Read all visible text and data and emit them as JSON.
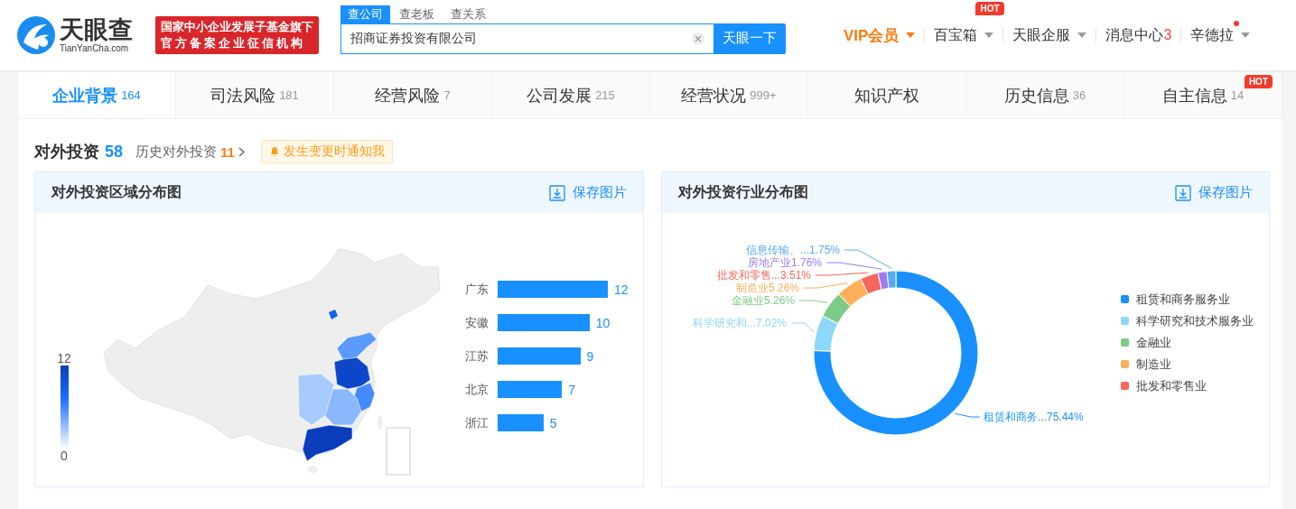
{
  "header": {
    "logo": {
      "name": "天眼查",
      "domain": "TianYanCha.com"
    },
    "slogan": [
      "国家中小企业发展子基金旗下",
      "官方备案企业征信机构"
    ],
    "search": {
      "tabs": [
        {
          "label": "查公司",
          "selected": true
        },
        {
          "label": "查老板",
          "selected": false
        },
        {
          "label": "查关系",
          "selected": false
        }
      ],
      "value": "招商证券投资有限公司",
      "button": "天眼一下"
    },
    "nav": [
      {
        "label": "VIP会员",
        "kind": "vip",
        "unread": false
      },
      {
        "label": "百宝箱",
        "kind": "menu",
        "badge": "HOT",
        "unread": false
      },
      {
        "label": "天眼企服",
        "kind": "menu",
        "unread": false
      },
      {
        "label": "消息中心",
        "kind": "message",
        "count": "3",
        "unread": false
      },
      {
        "label": "辛德拉",
        "kind": "menu",
        "unread": true
      }
    ]
  },
  "tabs": [
    {
      "label": "企业背景",
      "count": "164",
      "selected": true
    },
    {
      "label": "司法风险",
      "count": "181",
      "selected": false
    },
    {
      "label": "经营风险",
      "count": "7",
      "selected": false
    },
    {
      "label": "公司发展",
      "count": "215",
      "selected": false
    },
    {
      "label": "经营状况",
      "count": "999+",
      "selected": false
    },
    {
      "label": "知识产权",
      "selected": false
    },
    {
      "label": "历史信息",
      "count": "36",
      "selected": false
    },
    {
      "label": "自主信息",
      "count": "14",
      "badge": "HOT",
      "selected": false
    }
  ],
  "section": {
    "title": "对外投资",
    "count": "58",
    "history_label": "历史对外投资",
    "history_count": "11",
    "notify_button": "发生变更时通知我"
  },
  "region_card": {
    "title": "对外投资区域分布图",
    "save_button": "保存图片",
    "visual_map": {
      "max_label": "12",
      "min_label": "0"
    },
    "chart_data": {
      "type": "bar",
      "orientation": "horizontal",
      "categories": [
        "广东",
        "安徽",
        "江苏",
        "北京",
        "浙江"
      ],
      "values": [
        12,
        10,
        9,
        7,
        5
      ],
      "data_labels": true
    }
  },
  "industry_card": {
    "title": "对外投资行业分布图",
    "save_button": "保存图片",
    "chart_data": {
      "type": "donut",
      "categories": [
        "租赁和商务...",
        "科学研究和...",
        "金融业",
        "制造业",
        "批发和零售...",
        "房地产业",
        "信息传输、..."
      ],
      "values": [
        75.44,
        7.02,
        5.26,
        5.26,
        3.51,
        1.76,
        1.75
      ],
      "colors": [
        "#1890ff",
        "#8dd7fa",
        "#7ccb86",
        "#fdb05a",
        "#f4675a",
        "#9b7bf7",
        "#5aa9f6"
      ],
      "value_labels": [
        "75.44%",
        "7.02%",
        "5.26%",
        "5.26%",
        "3.51%",
        "1.76%",
        "1.75%"
      ]
    },
    "legend": [
      {
        "name": "租赁和商务服务业",
        "color": "#1890ff"
      },
      {
        "name": "科学研究和技术服务业",
        "color": "#8dd7fa"
      },
      {
        "name": "金融业",
        "color": "#7ccb86"
      },
      {
        "name": "制造业",
        "color": "#fdb05a"
      },
      {
        "name": "批发和零售业",
        "color": "#f4675a"
      }
    ]
  }
}
